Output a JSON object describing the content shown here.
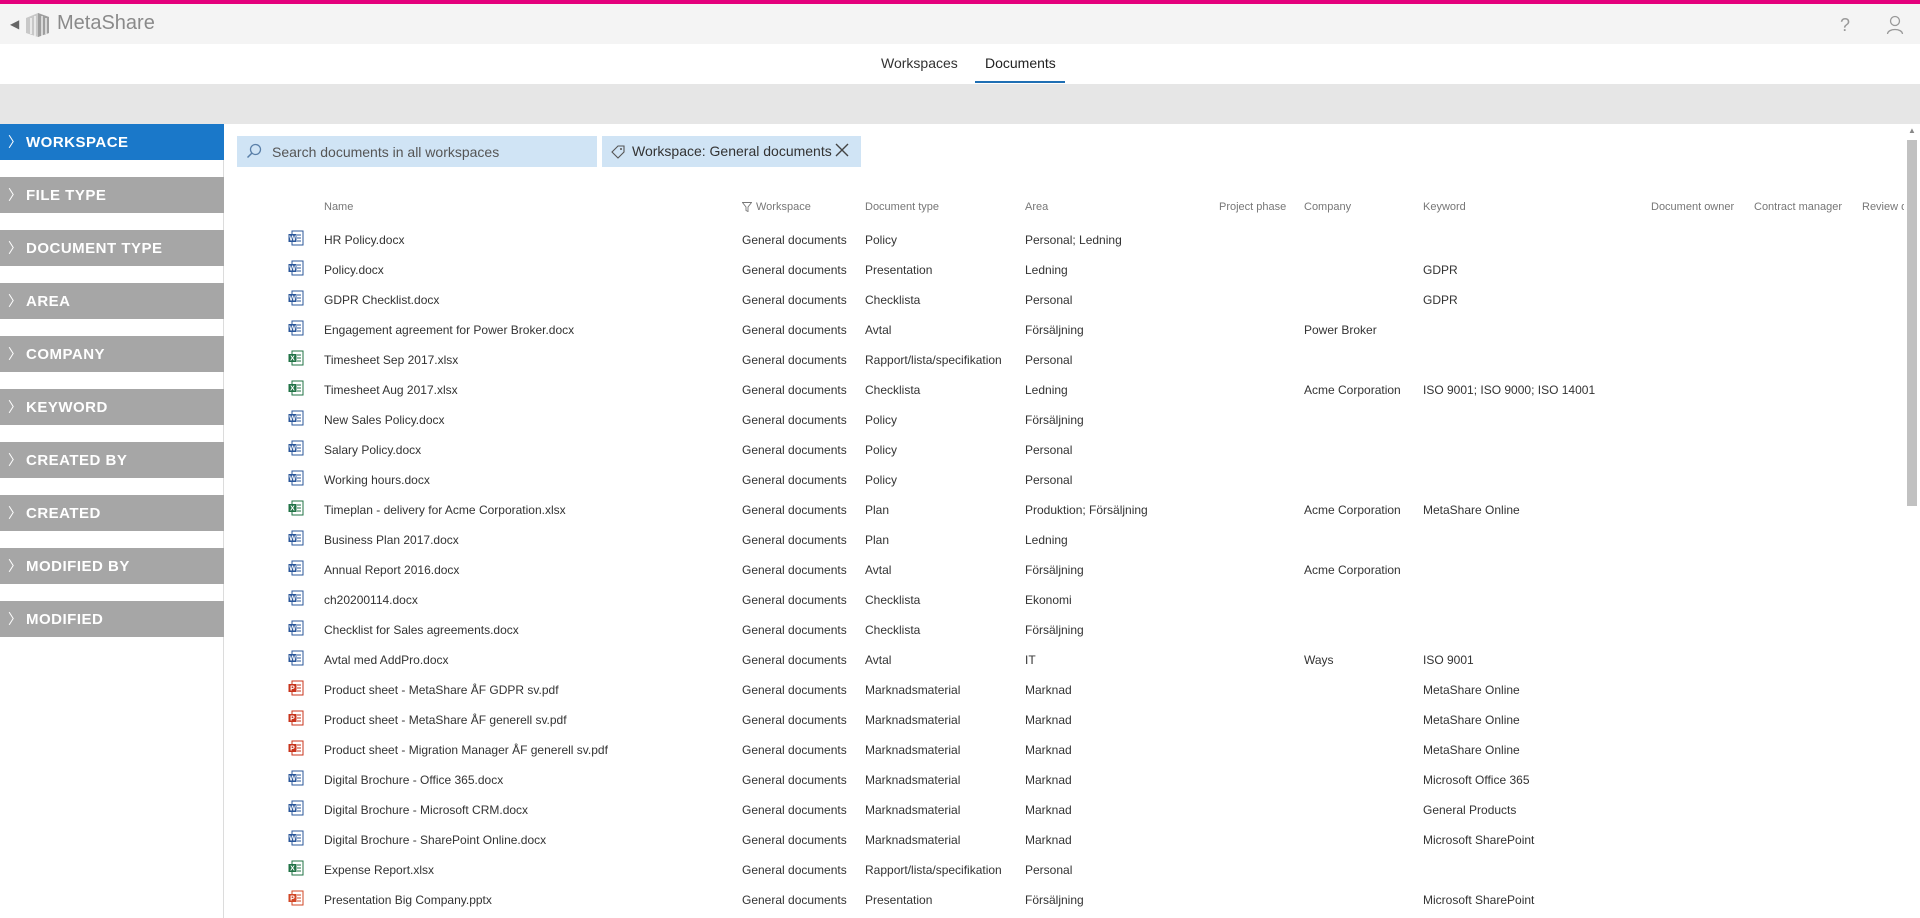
{
  "app": {
    "title": "MetaShare",
    "accent_color": "#e4007c",
    "icons": {
      "help": "?"
    }
  },
  "nav": {
    "tabs": [
      {
        "label": "Workspaces"
      },
      {
        "label": "Documents"
      }
    ],
    "active": "Documents"
  },
  "sidebar": {
    "active_color": "#1a78c9",
    "inactive_color": "#a6a6a6",
    "facets": [
      {
        "label": "WORKSPACE"
      },
      {
        "label": "FILE TYPE"
      },
      {
        "label": "DOCUMENT TYPE"
      },
      {
        "label": "AREA"
      },
      {
        "label": "COMPANY"
      },
      {
        "label": "KEYWORD"
      },
      {
        "label": "CREATED BY"
      },
      {
        "label": "CREATED"
      },
      {
        "label": "MODIFIED BY"
      },
      {
        "label": "MODIFIED"
      }
    ]
  },
  "search": {
    "placeholder": "Search documents in all workspaces"
  },
  "filter_chip": {
    "label": "Workspace: General documents"
  },
  "table": {
    "columns": [
      "Name",
      "Workspace",
      "Document type",
      "Area",
      "Project phase",
      "Company",
      "Keyword",
      "Document owner",
      "Contract manager",
      "Review d"
    ],
    "rows": [
      {
        "icon": "word",
        "name": "HR Policy.docx",
        "workspace": "General documents",
        "doctype": "Policy",
        "area": "Personal; Ledning",
        "company": "",
        "keyword": ""
      },
      {
        "icon": "word",
        "name": "Policy.docx",
        "workspace": "General documents",
        "doctype": "Presentation",
        "area": "Ledning",
        "company": "",
        "keyword": "GDPR"
      },
      {
        "icon": "word",
        "name": "GDPR Checklist.docx",
        "workspace": "General documents",
        "doctype": "Checklista",
        "area": "Personal",
        "company": "",
        "keyword": "GDPR"
      },
      {
        "icon": "word",
        "name": "Engagement agreement for Power Broker.docx",
        "workspace": "General documents",
        "doctype": "Avtal",
        "area": "Försäljning",
        "company": "Power Broker",
        "keyword": ""
      },
      {
        "icon": "excel",
        "name": "Timesheet Sep 2017.xlsx",
        "workspace": "General documents",
        "doctype": "Rapport/lista/specifikation",
        "area": "Personal",
        "company": "",
        "keyword": ""
      },
      {
        "icon": "excel",
        "name": "Timesheet Aug 2017.xlsx",
        "workspace": "General documents",
        "doctype": "Checklista",
        "area": "Ledning",
        "company": "Acme Corporation",
        "keyword": "ISO 9001; ISO 9000; ISO 14001"
      },
      {
        "icon": "word",
        "name": "New Sales Policy.docx",
        "workspace": "General documents",
        "doctype": "Policy",
        "area": "Försäljning",
        "company": "",
        "keyword": ""
      },
      {
        "icon": "word",
        "name": "Salary Policy.docx",
        "workspace": "General documents",
        "doctype": "Policy",
        "area": "Personal",
        "company": "",
        "keyword": ""
      },
      {
        "icon": "word",
        "name": "Working hours.docx",
        "workspace": "General documents",
        "doctype": "Policy",
        "area": "Personal",
        "company": "",
        "keyword": ""
      },
      {
        "icon": "excel",
        "name": "Timeplan - delivery for Acme Corporation.xlsx",
        "workspace": "General documents",
        "doctype": "Plan",
        "area": "Produktion; Försäljning",
        "company": "Acme Corporation",
        "keyword": "MetaShare Online"
      },
      {
        "icon": "word",
        "name": "Business Plan 2017.docx",
        "workspace": "General documents",
        "doctype": "Plan",
        "area": "Ledning",
        "company": "",
        "keyword": ""
      },
      {
        "icon": "word",
        "name": "Annual Report 2016.docx",
        "workspace": "General documents",
        "doctype": "Avtal",
        "area": "Försäljning",
        "company": "Acme Corporation",
        "keyword": ""
      },
      {
        "icon": "word",
        "name": "ch20200114.docx",
        "workspace": "General documents",
        "doctype": "Checklista",
        "area": "Ekonomi",
        "company": "",
        "keyword": ""
      },
      {
        "icon": "word",
        "name": "Checklist for Sales agreements.docx",
        "workspace": "General documents",
        "doctype": "Checklista",
        "area": "Försäljning",
        "company": "",
        "keyword": ""
      },
      {
        "icon": "word",
        "name": "Avtal med AddPro.docx",
        "workspace": "General documents",
        "doctype": "Avtal",
        "area": "IT",
        "company": "Ways",
        "keyword": "ISO 9001"
      },
      {
        "icon": "pdf",
        "name": "Product sheet - MetaShare ÅF GDPR sv.pdf",
        "workspace": "General documents",
        "doctype": "Marknadsmaterial",
        "area": "Marknad",
        "company": "",
        "keyword": "MetaShare Online"
      },
      {
        "icon": "pdf",
        "name": "Product sheet - MetaShare ÅF generell sv.pdf",
        "workspace": "General documents",
        "doctype": "Marknadsmaterial",
        "area": "Marknad",
        "company": "",
        "keyword": "MetaShare Online"
      },
      {
        "icon": "pdf",
        "name": "Product sheet - Migration Manager ÅF generell sv.pdf",
        "workspace": "General documents",
        "doctype": "Marknadsmaterial",
        "area": "Marknad",
        "company": "",
        "keyword": "MetaShare Online"
      },
      {
        "icon": "word",
        "name": "Digital Brochure - Office 365.docx",
        "workspace": "General documents",
        "doctype": "Marknadsmaterial",
        "area": "Marknad",
        "company": "",
        "keyword": "Microsoft Office 365"
      },
      {
        "icon": "word",
        "name": "Digital Brochure - Microsoft CRM.docx",
        "workspace": "General documents",
        "doctype": "Marknadsmaterial",
        "area": "Marknad",
        "company": "",
        "keyword": "General Products"
      },
      {
        "icon": "word",
        "name": "Digital Brochure - SharePoint Online.docx",
        "workspace": "General documents",
        "doctype": "Marknadsmaterial",
        "area": "Marknad",
        "company": "",
        "keyword": "Microsoft SharePoint"
      },
      {
        "icon": "excel",
        "name": "Expense Report.xlsx",
        "workspace": "General documents",
        "doctype": "Rapport/lista/specifikation",
        "area": "Personal",
        "company": "",
        "keyword": ""
      },
      {
        "icon": "ppt",
        "name": "Presentation Big Company.pptx",
        "workspace": "General documents",
        "doctype": "Presentation",
        "area": "Försäljning",
        "company": "",
        "keyword": "Microsoft SharePoint"
      }
    ]
  }
}
